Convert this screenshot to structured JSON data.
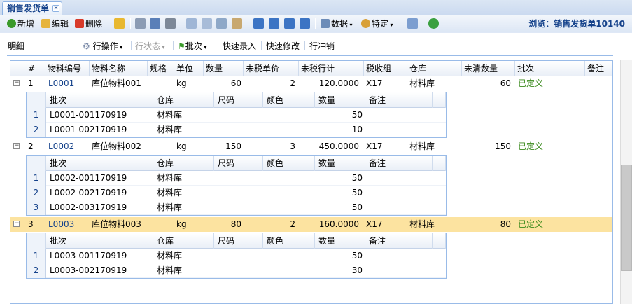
{
  "tab": {
    "title": "销售发货单"
  },
  "toolbar": {
    "new_label": "新增",
    "edit_label": "编辑",
    "delete_label": "删除",
    "data_label": "数据",
    "special_label": "特定",
    "browse_text": "浏览：销售发货单10140"
  },
  "subbar": {
    "title": "明细",
    "row_ops": "行操作",
    "row_status": "行状态",
    "batch": "批次",
    "quick_entry": "快速录入",
    "quick_edit": "快速修改",
    "row_reverse": "行冲销"
  },
  "columns": [
    "#",
    "物料编号",
    "物料名称",
    "规格",
    "单位",
    "数量",
    "未税单价",
    "未税行计",
    "税收组",
    "仓库",
    "未清数量",
    "批次",
    "备注"
  ],
  "sub_columns": [
    "批次",
    "仓库",
    "尺码",
    "颜色",
    "数量",
    "备注"
  ],
  "rows": [
    {
      "num": "1",
      "code": "L0001",
      "name": "库位物料001",
      "unit": "kg",
      "qty": "60",
      "price": "2",
      "total": "120.0000",
      "tax": "X17",
      "wh": "材料库",
      "open": "60",
      "batch": "已定义",
      "subs": [
        {
          "n": "1",
          "batch": "L0001-001170919",
          "wh": "材料库",
          "qty": "50"
        },
        {
          "n": "2",
          "batch": "L0001-002170919",
          "wh": "材料库",
          "qty": "10"
        }
      ]
    },
    {
      "num": "2",
      "code": "L0002",
      "name": "库位物料002",
      "unit": "kg",
      "qty": "150",
      "price": "3",
      "total": "450.0000",
      "tax": "X17",
      "wh": "材料库",
      "open": "150",
      "batch": "已定义",
      "subs": [
        {
          "n": "1",
          "batch": "L0002-001170919",
          "wh": "材料库",
          "qty": "50"
        },
        {
          "n": "2",
          "batch": "L0002-002170919",
          "wh": "材料库",
          "qty": "50"
        },
        {
          "n": "3",
          "batch": "L0002-003170919",
          "wh": "材料库",
          "qty": "50"
        }
      ]
    },
    {
      "num": "3",
      "code": "L0003",
      "name": "库位物料003",
      "unit": "kg",
      "qty": "80",
      "price": "2",
      "total": "160.0000",
      "tax": "X17",
      "wh": "材料库",
      "open": "80",
      "batch": "已定义",
      "subs": [
        {
          "n": "1",
          "batch": "L0003-001170919",
          "wh": "材料库",
          "qty": "50"
        },
        {
          "n": "2",
          "batch": "L0003-002170919",
          "wh": "材料库",
          "qty": "30"
        }
      ]
    }
  ]
}
